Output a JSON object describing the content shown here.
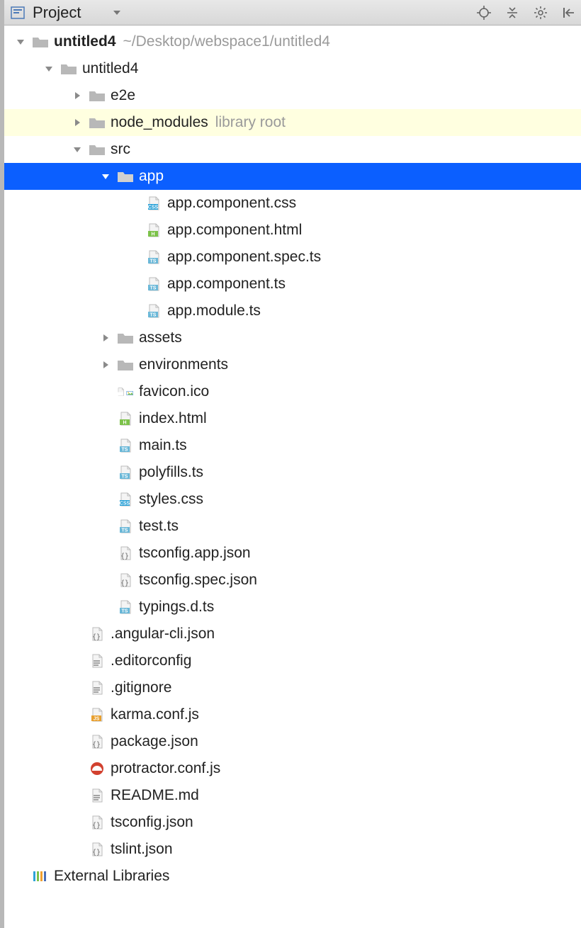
{
  "toolbar": {
    "view_label": "Project"
  },
  "tree": [
    {
      "depth": 0,
      "arrow": "down",
      "icon": "folder",
      "label": "untitled4",
      "bold": true,
      "hint": "~/Desktop/webspace1/untitled4"
    },
    {
      "depth": 1,
      "arrow": "down",
      "icon": "folder",
      "label": "untitled4"
    },
    {
      "depth": 2,
      "arrow": "right",
      "icon": "folder",
      "label": "e2e"
    },
    {
      "depth": 2,
      "arrow": "right",
      "icon": "folder",
      "label": "node_modules",
      "hint": "library root",
      "lib": true
    },
    {
      "depth": 2,
      "arrow": "down",
      "icon": "folder",
      "label": "src"
    },
    {
      "depth": 3,
      "arrow": "down",
      "icon": "folder",
      "label": "app",
      "selected": true
    },
    {
      "depth": 4,
      "arrow": "none",
      "icon": "css",
      "label": "app.component.css"
    },
    {
      "depth": 4,
      "arrow": "none",
      "icon": "html",
      "label": "app.component.html"
    },
    {
      "depth": 4,
      "arrow": "none",
      "icon": "ts",
      "label": "app.component.spec.ts"
    },
    {
      "depth": 4,
      "arrow": "none",
      "icon": "ts",
      "label": "app.component.ts"
    },
    {
      "depth": 4,
      "arrow": "none",
      "icon": "ts",
      "label": "app.module.ts"
    },
    {
      "depth": 3,
      "arrow": "right",
      "icon": "folder",
      "label": "assets"
    },
    {
      "depth": 3,
      "arrow": "right",
      "icon": "folder",
      "label": "environments"
    },
    {
      "depth": 3,
      "arrow": "none",
      "icon": "img",
      "label": "favicon.ico"
    },
    {
      "depth": 3,
      "arrow": "none",
      "icon": "html",
      "label": "index.html"
    },
    {
      "depth": 3,
      "arrow": "none",
      "icon": "ts",
      "label": "main.ts"
    },
    {
      "depth": 3,
      "arrow": "none",
      "icon": "ts",
      "label": "polyfills.ts"
    },
    {
      "depth": 3,
      "arrow": "none",
      "icon": "css",
      "label": "styles.css"
    },
    {
      "depth": 3,
      "arrow": "none",
      "icon": "ts",
      "label": "test.ts"
    },
    {
      "depth": 3,
      "arrow": "none",
      "icon": "json",
      "label": "tsconfig.app.json"
    },
    {
      "depth": 3,
      "arrow": "none",
      "icon": "json",
      "label": "tsconfig.spec.json"
    },
    {
      "depth": 3,
      "arrow": "none",
      "icon": "ts",
      "label": "typings.d.ts"
    },
    {
      "depth": 2,
      "arrow": "none",
      "icon": "json",
      "label": ".angular-cli.json"
    },
    {
      "depth": 2,
      "arrow": "none",
      "icon": "text",
      "label": ".editorconfig"
    },
    {
      "depth": 2,
      "arrow": "none",
      "icon": "text",
      "label": ".gitignore"
    },
    {
      "depth": 2,
      "arrow": "none",
      "icon": "js",
      "label": "karma.conf.js"
    },
    {
      "depth": 2,
      "arrow": "none",
      "icon": "json",
      "label": "package.json"
    },
    {
      "depth": 2,
      "arrow": "none",
      "icon": "protractor",
      "label": "protractor.conf.js"
    },
    {
      "depth": 2,
      "arrow": "none",
      "icon": "text",
      "label": "README.md"
    },
    {
      "depth": 2,
      "arrow": "none",
      "icon": "json",
      "label": "tsconfig.json"
    },
    {
      "depth": 2,
      "arrow": "none",
      "icon": "json",
      "label": "tslint.json"
    },
    {
      "depth": 0,
      "arrow": "none",
      "icon": "libs",
      "label": "External Libraries"
    }
  ]
}
